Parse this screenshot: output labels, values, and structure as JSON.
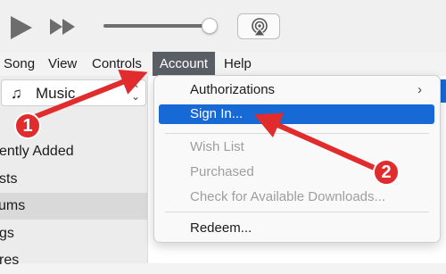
{
  "toolbar": {
    "volume_percent": 96
  },
  "menubar": {
    "items": [
      {
        "label": "Song"
      },
      {
        "label": "View"
      },
      {
        "label": "Controls"
      },
      {
        "label": "Account"
      },
      {
        "label": "Help"
      }
    ]
  },
  "sidebar": {
    "source_select": {
      "label": "Music"
    },
    "items": [
      {
        "label": "ently Added"
      },
      {
        "label": "sts"
      },
      {
        "label": "ums"
      },
      {
        "label": "gs"
      },
      {
        "label": "res"
      }
    ]
  },
  "dropdown": {
    "items": [
      {
        "label": "Authorizations",
        "submenu": "›"
      },
      {
        "label": "Sign In..."
      },
      {
        "label": "Wish List"
      },
      {
        "label": "Purchased"
      },
      {
        "label": "Check for Available Downloads..."
      },
      {
        "label": "Redeem..."
      }
    ]
  },
  "annotations": {
    "badge1": "1",
    "badge2": "2",
    "color": "#e02c2c"
  }
}
